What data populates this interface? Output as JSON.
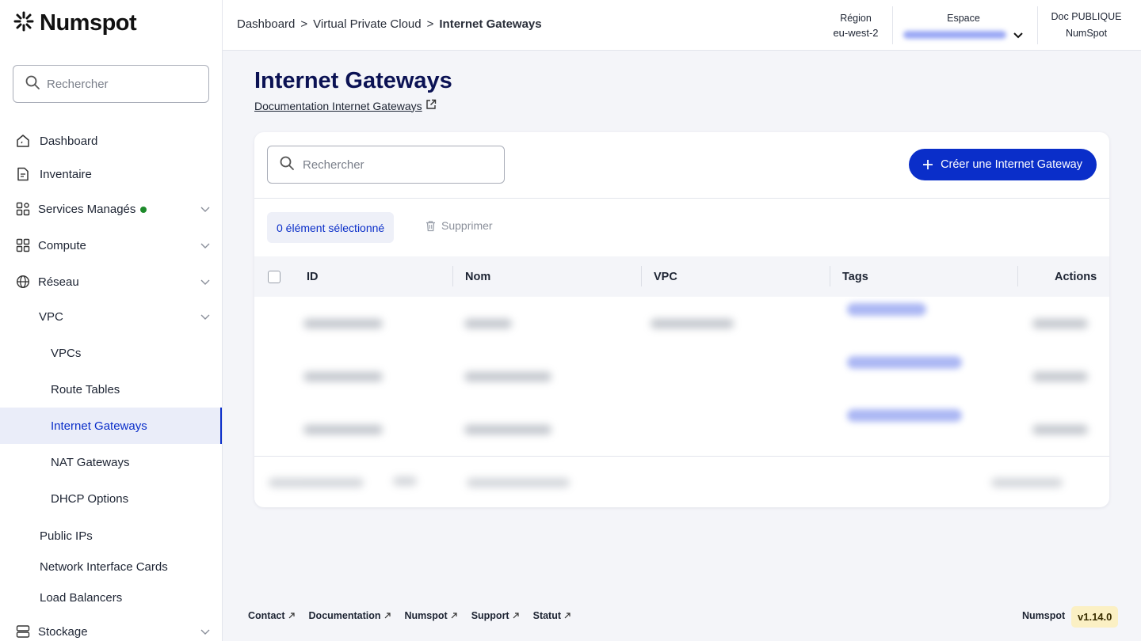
{
  "brand": {
    "name": "Numspot"
  },
  "sidebar": {
    "search_placeholder": "Rechercher",
    "items": [
      {
        "label": "Dashboard"
      },
      {
        "label": "Inventaire"
      },
      {
        "label": "Services Managés"
      },
      {
        "label": "Compute"
      },
      {
        "label": "Réseau"
      },
      {
        "label": "VPC"
      },
      {
        "label": "VPCs"
      },
      {
        "label": "Route Tables"
      },
      {
        "label": "Internet Gateways"
      },
      {
        "label": "NAT Gateways"
      },
      {
        "label": "DHCP Options"
      },
      {
        "label": "Public IPs"
      },
      {
        "label": "Network Interface Cards"
      },
      {
        "label": "Load Balancers"
      },
      {
        "label": "Stockage"
      }
    ]
  },
  "topbar": {
    "breadcrumb": [
      {
        "label": "Dashboard"
      },
      {
        "label": "Virtual Private Cloud"
      },
      {
        "label": "Internet Gateways"
      }
    ],
    "separator": ">",
    "region_label": "Région",
    "region_value": "eu-west-2",
    "space_label": "Espace",
    "doc_label": "Doc PUBLIQUE",
    "doc_value": "NumSpot"
  },
  "main": {
    "title": "Internet Gateways",
    "doc_link": "Documentation Internet Gateways",
    "search_placeholder": "Rechercher",
    "create_button": "Créer une Internet Gateway",
    "selected_badge": "0 élément sélectionné",
    "delete_button": "Supprimer",
    "columns": [
      "ID",
      "Nom",
      "VPC",
      "Tags",
      "Actions"
    ]
  },
  "footer": {
    "links": [
      "Contact",
      "Documentation",
      "Numspot",
      "Support",
      "Statut"
    ],
    "brand": "Numspot",
    "version": "v1.14.0"
  },
  "colors": {
    "primary": "#0a2ec9",
    "title": "#0b1254",
    "status_ok": "#1d8a2a",
    "version_bg": "#fbf0c4"
  }
}
